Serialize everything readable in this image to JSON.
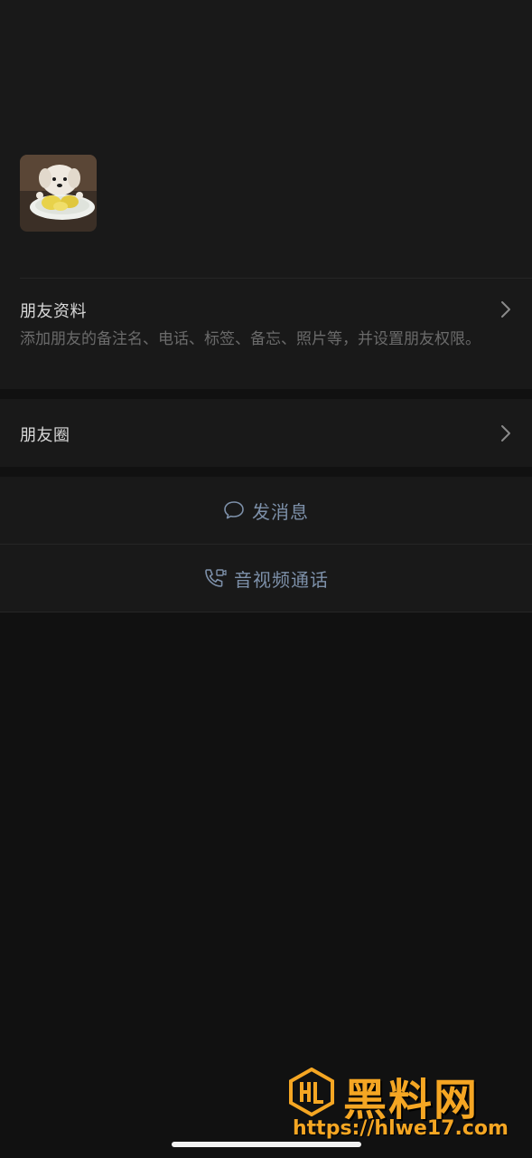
{
  "profile": {
    "avatar_icon": "dog-avatar-photo"
  },
  "rows": {
    "friend_info_title": "朋友资料",
    "friend_info_desc": "添加朋友的备注名、电话、标签、备忘、照片等，并设置朋友权限。",
    "moments_title": "朋友圈"
  },
  "actions": {
    "message_label": "发消息",
    "call_label": "音视频通话",
    "accent_color": "#7d90a9"
  },
  "watermark": {
    "brand": "黑料网",
    "url": "https://hlwe17.com",
    "color": "#f5a623"
  }
}
